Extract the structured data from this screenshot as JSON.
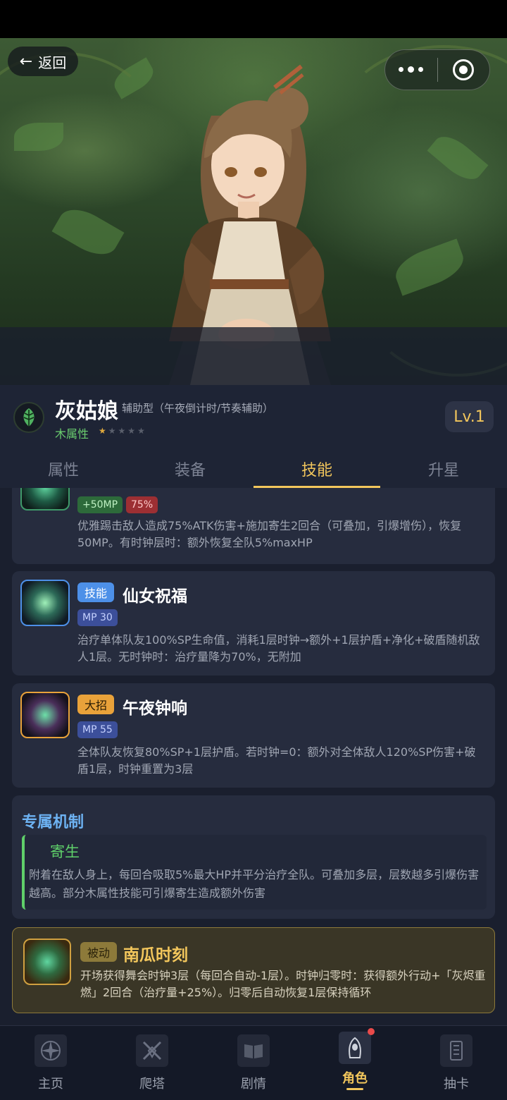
{
  "header": {
    "back_label": "返回"
  },
  "profile": {
    "name": "灰姑娘",
    "role": "辅助型（午夜倒计时/节奏辅助）",
    "attribute": "木属性",
    "stars_total": 5,
    "stars_filled": 1,
    "level": "Lv.1"
  },
  "tabs": [
    {
      "label": "属性"
    },
    {
      "label": "装备"
    },
    {
      "label": "技能",
      "active": true
    },
    {
      "label": "升星"
    }
  ],
  "skills": [
    {
      "tags": [
        "+50MP",
        "75%"
      ],
      "description": "优雅踢击敌人造成75%ATK伤害+施加寄生2回合（可叠加，引爆增伤），恢复50MP。有时钟层时：额外恢复全队5%maxHP"
    },
    {
      "type": "技能",
      "name": "仙女祝福",
      "cost": "MP 30",
      "description": "治疗单体队友100%SP生命值，消耗1层时钟→额外+1层护盾+净化+破盾随机敌人1层。无时钟时：治疗量降为70%，无附加"
    },
    {
      "type": "大招",
      "name": "午夜钟响",
      "cost": "MP 55",
      "description": "全体队友恢复80%SP+1层护盾。若时钟=0：额外对全体敌人120%SP伤害+破盾1层，时钟重置为3层"
    }
  ],
  "mechanic": {
    "title": "专属机制",
    "name": "寄生",
    "description": "附着在敌人身上，每回合吸取5%最大HP并平分治疗全队。可叠加多层，层数越多引爆伤害越高。部分木属性技能可引爆寄生造成额外伤害"
  },
  "passive": {
    "type": "被动",
    "name": "南瓜时刻",
    "description": "开场获得舞会时钟3层（每回合自动-1层）。时钟归零时：获得额外行动+「灰烬重燃」2回合（治疗量+25%）。归零后自动恢复1层保持循环"
  },
  "bottom_nav": [
    {
      "label": "主页",
      "icon": "compass-icon"
    },
    {
      "label": "爬塔",
      "icon": "crossed-swords-icon"
    },
    {
      "label": "剧情",
      "icon": "book-icon"
    },
    {
      "label": "角色",
      "icon": "hooded-figure-icon",
      "active": true,
      "badge": true
    },
    {
      "label": "抽卡",
      "icon": "card-icon"
    }
  ],
  "colors": {
    "accent_gold": "#f2c65c",
    "wood_green": "#6bcf6f",
    "mechanic_blue": "#6db2f2",
    "skill_badge_blue": "#4d90e8",
    "ultimate_badge_orange": "#e9a23a",
    "passive_badge": "#8d7a3a"
  }
}
